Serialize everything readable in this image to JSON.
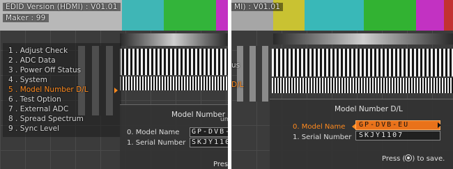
{
  "left_photo": {
    "osd_header": {
      "edid_version": "EDID Version (HDMI) : V01.01",
      "maker": "Maker : 99"
    },
    "menu": {
      "items": [
        {
          "label": "1 . Adjust Check"
        },
        {
          "label": "2 . ADC Data"
        },
        {
          "label": "3 . Power Off Status"
        },
        {
          "label": "4 . System"
        },
        {
          "label": "5 . Model Number D/L"
        },
        {
          "label": "6 . Test Option"
        },
        {
          "label": "7 . External ADC"
        },
        {
          "label": "8 . Spread Spectrum"
        },
        {
          "label": "9 . Sync Level"
        }
      ],
      "selected_index": 4
    },
    "dialog": {
      "title": "Model Number D/L",
      "title_tail": "um",
      "model_name_label": "0. Model Name",
      "model_name_value": "GP-DVB-",
      "serial_label": "1. Serial Number",
      "serial_value": "SKJY110",
      "hint_partial": "Press"
    }
  },
  "right_photo": {
    "osd_header": "MI) : V01.01",
    "menu_fragments": {
      "us": "us",
      "dl": "D/L"
    },
    "dialog": {
      "title": "Model Number D/L",
      "model_name_label": "0. Model Name",
      "model_name_value": "GP-DVB-EU",
      "serial_label": "1. Serial Number",
      "serial_value": "SKJY1107",
      "hint_prefix": "Press (",
      "hint_suffix": ") to save.",
      "active_field": "model_name"
    }
  },
  "colors": {
    "highlight": "#ff8a1e",
    "active_box": "#e9721a",
    "bar_yellow": "#c9c232",
    "bar_cyan": "#39b8b8",
    "bar_green": "#32b232",
    "bar_magenta": "#c232c2",
    "bar_red": "#c23232"
  }
}
